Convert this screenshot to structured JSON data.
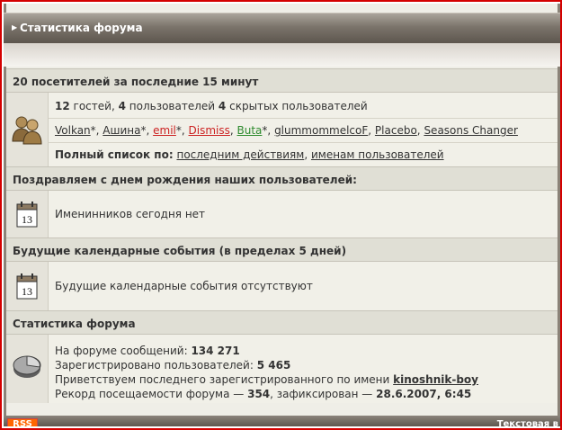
{
  "header": {
    "title": "Статистика форума"
  },
  "online": {
    "heading": "20 посетителей за последние 15 минут",
    "summary": {
      "guests": "12",
      "guests_label": "гостей,",
      "users": "4",
      "users_label": "пользователей",
      "hidden": "4",
      "hidden_label": "скрытых пользователей"
    },
    "users": [
      {
        "name": "Volkan",
        "suffix": "*, ",
        "color": "#333333"
      },
      {
        "name": "Ашина",
        "suffix": "*, ",
        "color": "#333333"
      },
      {
        "name": "emil",
        "suffix": "*, ",
        "color": "#cc2222"
      },
      {
        "name": "Dismiss",
        "suffix": ", ",
        "color": "#cc2222"
      },
      {
        "name": "Buta",
        "suffix": "*, ",
        "color": "#2d8a2d"
      },
      {
        "name": "glummommelcoF",
        "suffix": ", ",
        "color": "#333333"
      },
      {
        "name": "Placebo",
        "suffix": ", ",
        "color": "#333333"
      },
      {
        "name": "Seasons Changer",
        "suffix": "",
        "color": "#333333"
      }
    ],
    "fulllist": {
      "label": "Полный список по:",
      "by_action": "последним действиям",
      "sep": ", ",
      "by_name": "именам пользователей"
    }
  },
  "birthdays": {
    "heading": "Поздравляем с днем рождения наших пользователей:",
    "text": "Именинников сегодня нет",
    "cal_number": "13"
  },
  "events": {
    "heading": "Будущие календарные события (в пределах 5 дней)",
    "text": "Будущие календарные события отсутствуют",
    "cal_number": "13"
  },
  "stats": {
    "heading": "Статистика форума",
    "posts_label": "На форуме сообщений:",
    "posts": "134 271",
    "members_label": "Зарегистрировано пользователей:",
    "members": "5 465",
    "newest_label": "Приветствуем последнего зарегистрированного по имени",
    "newest": "kinoshnik-boy",
    "record_label": "Рекорд посещаемости форума —",
    "record": "354",
    "record_mid": ", зафиксирован —",
    "record_date": "28.6.2007, 6:45"
  },
  "footer": {
    "rss": "RSS",
    "text_version": "Текстовая в"
  }
}
